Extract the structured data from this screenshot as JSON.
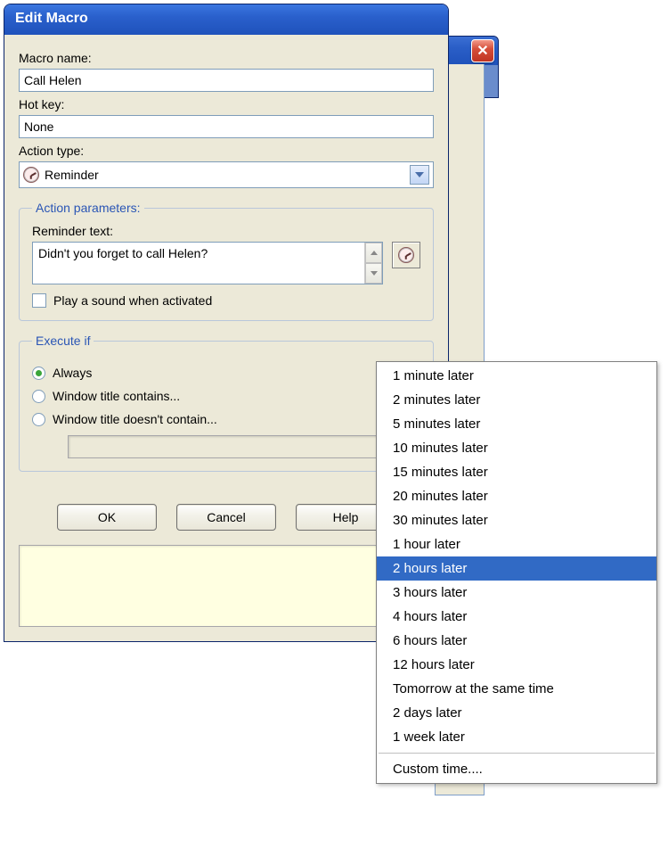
{
  "dialog": {
    "title": "Edit Macro",
    "macro_name_label": "Macro name:",
    "macro_name_value": "Call Helen",
    "hotkey_label": "Hot key:",
    "hotkey_value": "None",
    "action_type_label": "Action type:",
    "action_type_value": "Reminder",
    "params_legend": "Action parameters:",
    "reminder_text_label": "Reminder text:",
    "reminder_text_value": "Didn't you forget to call Helen?",
    "play_sound_label": "Play a sound when activated",
    "execute_legend": "Execute if",
    "radios": {
      "always": "Always",
      "title_contains": "Window title contains...",
      "title_not_contains": "Window title doesn't contain..."
    },
    "buttons": {
      "ok": "OK",
      "cancel": "Cancel",
      "help": "Help"
    }
  },
  "menu": {
    "items": [
      "1 minute later",
      "2 minutes later",
      "5 minutes later",
      "10 minutes later",
      "15 minutes later",
      "20 minutes later",
      "30 minutes later",
      "1 hour later",
      "2 hours later",
      "3 hours later",
      "4 hours later",
      "6 hours later",
      "12 hours later",
      "Tomorrow at the same time",
      "2 days later",
      "1 week later"
    ],
    "highlight_index": 8,
    "custom": "Custom time...."
  },
  "back_window": {
    "close_glyph": "✕"
  }
}
